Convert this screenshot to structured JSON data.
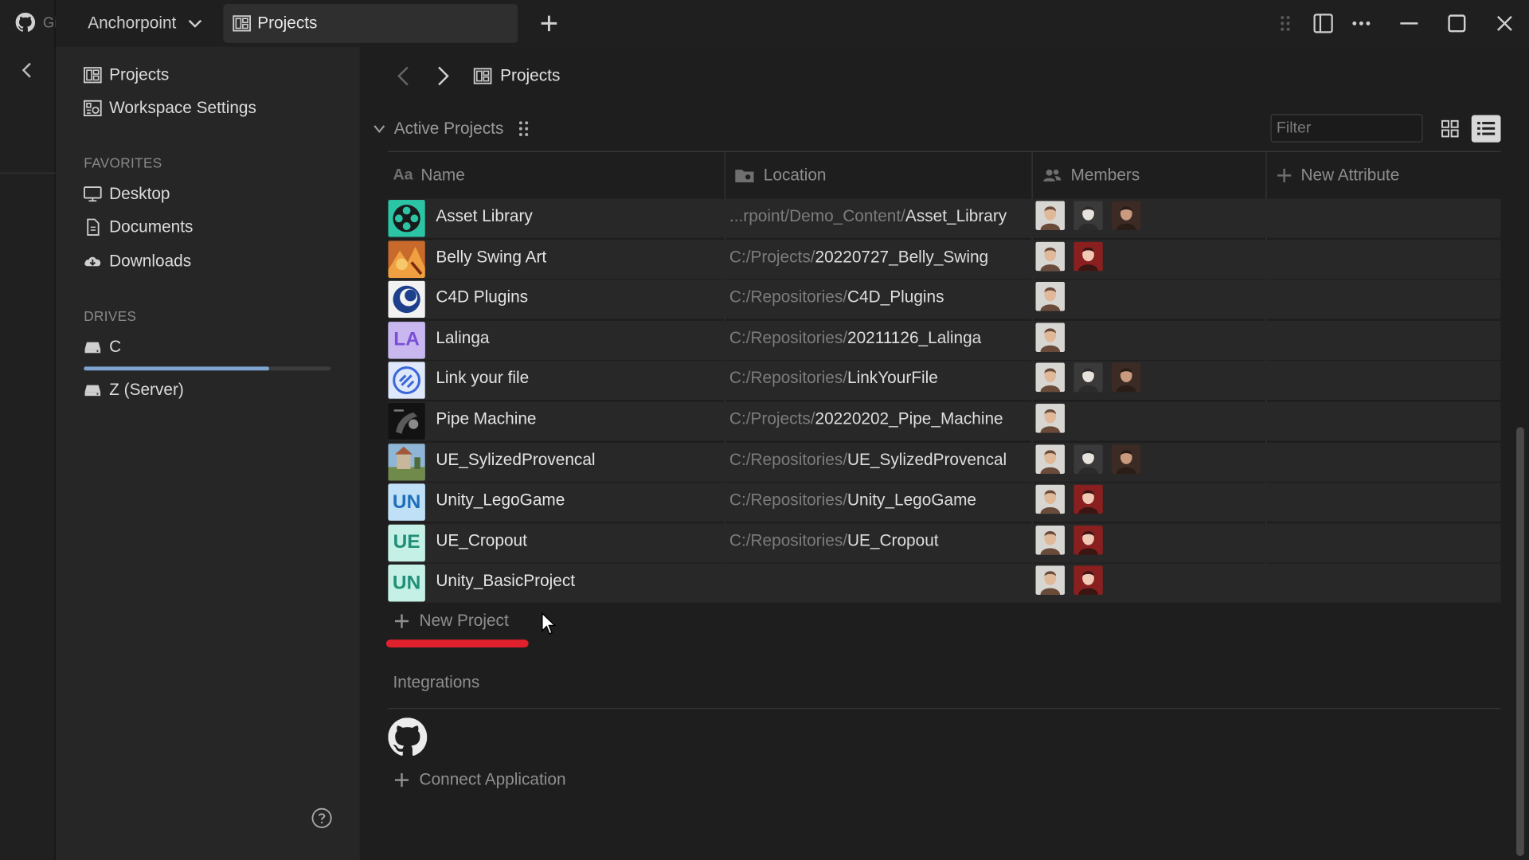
{
  "outer": {
    "app_text": "Gi"
  },
  "titlebar": {
    "workspace": "Anchorpoint",
    "tab_label": "Projects"
  },
  "sidebar": {
    "top_items": [
      {
        "label": "Projects"
      },
      {
        "label": "Workspace Settings"
      }
    ],
    "favorites_heading": "FAVORITES",
    "favorites": [
      {
        "label": "Desktop"
      },
      {
        "label": "Documents"
      },
      {
        "label": "Downloads"
      }
    ],
    "drives_heading": "DRIVES",
    "drives": [
      {
        "label": "C",
        "usage": 0.75
      },
      {
        "label": "Z (Server)"
      }
    ]
  },
  "main": {
    "breadcrumb": "Projects",
    "section_title": "Active Projects",
    "filter_placeholder": "Filter",
    "columns": {
      "name": "Name",
      "location": "Location",
      "members": "Members",
      "new_attribute": "New Attribute"
    },
    "rows": [
      {
        "name": "Asset Library",
        "loc_prefix": "...rpoint/Demo_Content/",
        "loc_rest": "Asset_Library",
        "thumb": "asset-library-icon",
        "members": [
          "m1",
          "m2",
          "m3"
        ]
      },
      {
        "name": "Belly Swing Art",
        "loc_prefix": "C:/Projects/",
        "loc_rest": "20220727_Belly_Swing",
        "thumb": "belly-swing-art-thumbnail",
        "members": [
          "m1",
          "m4"
        ]
      },
      {
        "name": "C4D Plugins",
        "loc_prefix": "C:/Repositories/",
        "loc_rest": "C4D_Plugins",
        "thumb": "c4d-icon",
        "members": [
          "m1"
        ]
      },
      {
        "name": "Lalinga",
        "loc_prefix": "C:/Repositories/",
        "loc_rest": "20211126_Lalinga",
        "thumb_text": "LA",
        "thumb_bg": "#c9b8f0",
        "thumb_fg": "#7a4fd6",
        "members": [
          "m1"
        ]
      },
      {
        "name": "Link your file",
        "loc_prefix": "C:/Repositories/",
        "loc_rest": "LinkYourFile",
        "thumb": "link-icon",
        "members": [
          "m1",
          "m2",
          "m3"
        ]
      },
      {
        "name": "Pipe Machine",
        "loc_prefix": "C:/Projects/",
        "loc_rest": "20220202_Pipe_Machine",
        "thumb": "pipe-machine-thumbnail",
        "members": [
          "m1"
        ]
      },
      {
        "name": "UE_SylizedProvencal",
        "loc_prefix": "C:/Repositories/",
        "loc_rest": "UE_SylizedProvencal",
        "thumb": "provencal-thumbnail",
        "members": [
          "m1",
          "m2",
          "m3"
        ]
      },
      {
        "name": "Unity_LegoGame",
        "loc_prefix": "C:/Repositories/",
        "loc_rest": "Unity_LegoGame",
        "thumb_text": "UN",
        "thumb_bg": "#bfe0f7",
        "thumb_fg": "#1e6fb8",
        "members": [
          "m1",
          "m4"
        ]
      },
      {
        "name": "UE_Cropout",
        "loc_prefix": "C:/Repositories/",
        "loc_rest": "UE_Cropout",
        "thumb_text": "UE",
        "thumb_bg": "#c4f0e6",
        "thumb_fg": "#1f8f77",
        "members": [
          "m1",
          "m4"
        ]
      },
      {
        "name": "Unity_BasicProject",
        "loc_prefix": "",
        "loc_rest": "",
        "thumb_text": "UN",
        "thumb_bg": "#c4f0e6",
        "thumb_fg": "#1f8f77",
        "members": [
          "m1",
          "m4"
        ]
      }
    ],
    "new_project": "New Project",
    "integrations_heading": "Integrations",
    "connect_application": "Connect Application"
  },
  "colors": {
    "accent_red": "#e0212d",
    "drive_bar": "#7ea4d1"
  }
}
